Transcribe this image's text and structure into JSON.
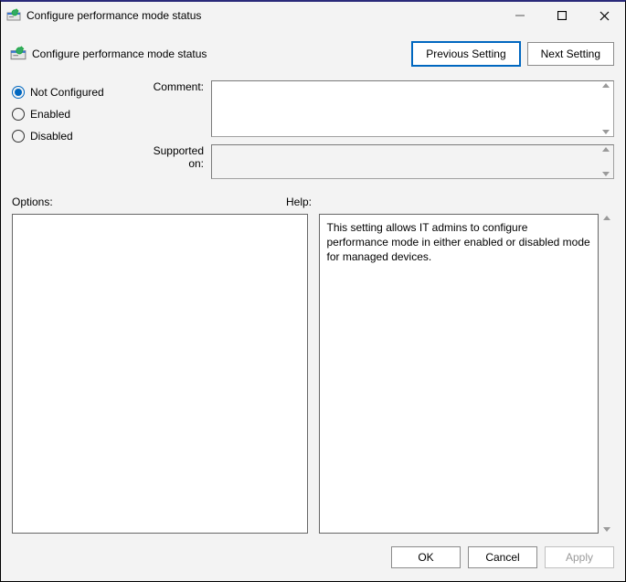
{
  "window": {
    "title": "Configure performance mode status"
  },
  "subheader": {
    "title": "Configure performance mode status"
  },
  "nav": {
    "prev": "Previous Setting",
    "next": "Next Setting"
  },
  "radios": {
    "not_configured": "Not Configured",
    "enabled": "Enabled",
    "disabled": "Disabled",
    "selected": "not_configured"
  },
  "fields": {
    "comment_label": "Comment:",
    "comment_value": "",
    "supported_label": "Supported on:",
    "supported_value": ""
  },
  "sections": {
    "options_label": "Options:",
    "help_label": "Help:",
    "options_text": "",
    "help_text": "This setting allows IT admins to configure performance mode in either enabled or disabled mode for managed devices."
  },
  "footer": {
    "ok": "OK",
    "cancel": "Cancel",
    "apply": "Apply"
  }
}
